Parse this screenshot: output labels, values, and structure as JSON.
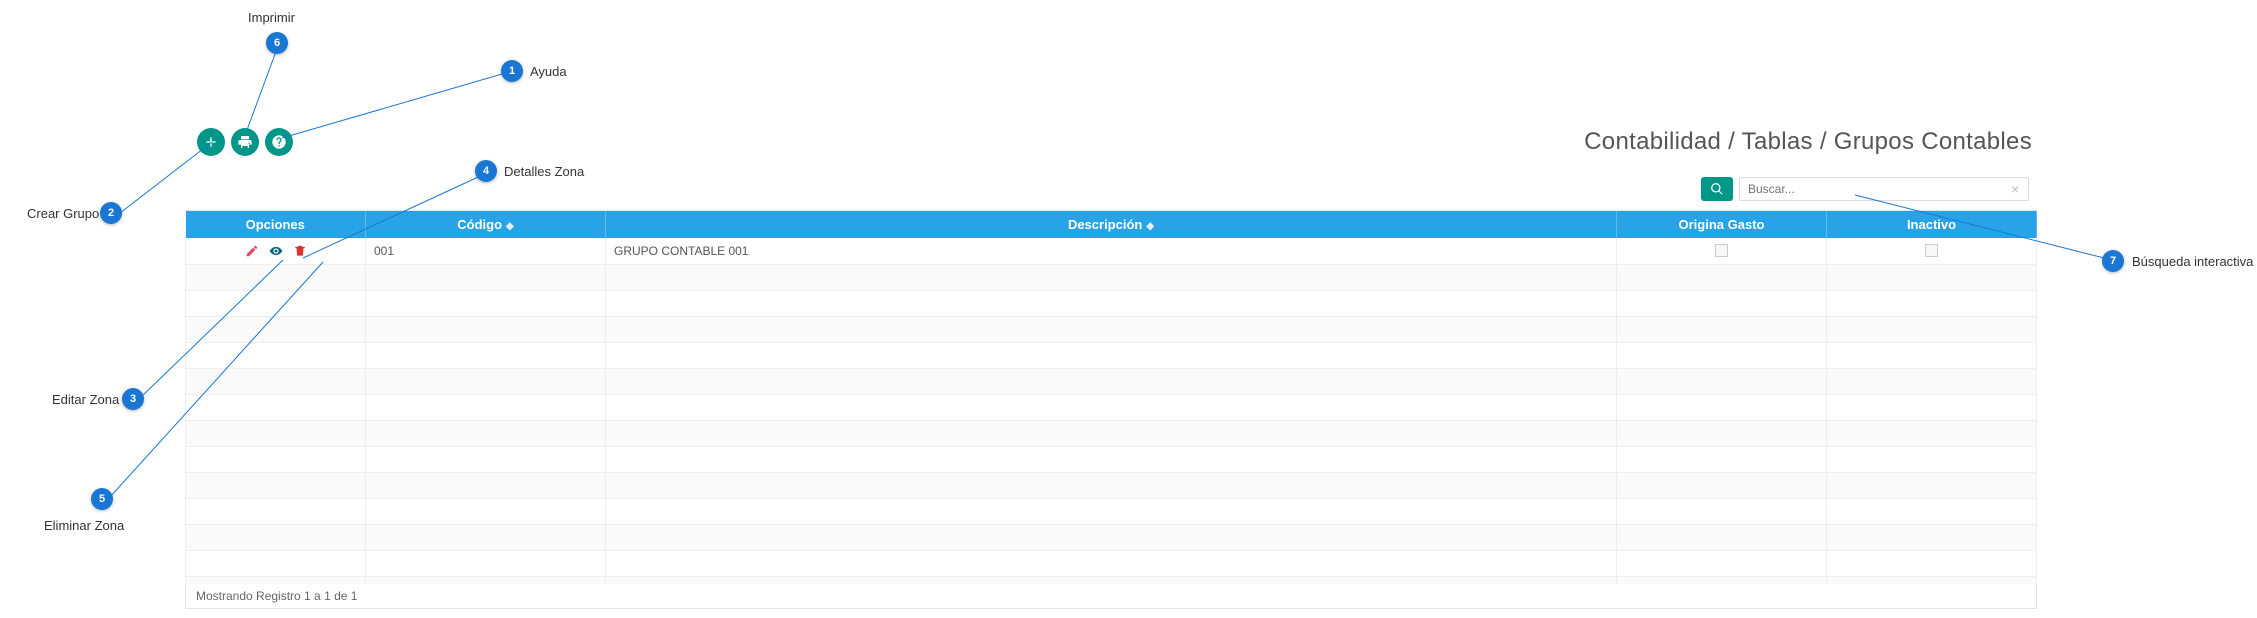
{
  "callouts": {
    "1": {
      "label": "Ayuda"
    },
    "2": {
      "label": "Crear Grupo"
    },
    "3": {
      "label": "Editar Zona"
    },
    "4": {
      "label": "Detalles Zona"
    },
    "5": {
      "label": "Eliminar Zona"
    },
    "6": {
      "label": "Imprimir"
    },
    "7": {
      "label": "Búsqueda interactiva"
    }
  },
  "breadcrumb": "Contabilidad / Tablas / Grupos Contables",
  "toolbar": {
    "create_name": "create-group-button",
    "print_name": "print-button",
    "help_name": "help-button"
  },
  "search": {
    "placeholder": "Buscar...",
    "value": ""
  },
  "table": {
    "headers": {
      "opciones": "Opciones",
      "codigo": "Código",
      "descripcion": "Descripción",
      "origina_gasto": "Origina Gasto",
      "inactivo": "Inactivo"
    },
    "rows": [
      {
        "codigo": "001",
        "descripcion": "GRUPO CONTABLE 001",
        "origina_gasto": false,
        "inactivo": false
      }
    ],
    "empty_row_count": 13,
    "footer": "Mostrando Registro 1 a 1 de 1"
  }
}
